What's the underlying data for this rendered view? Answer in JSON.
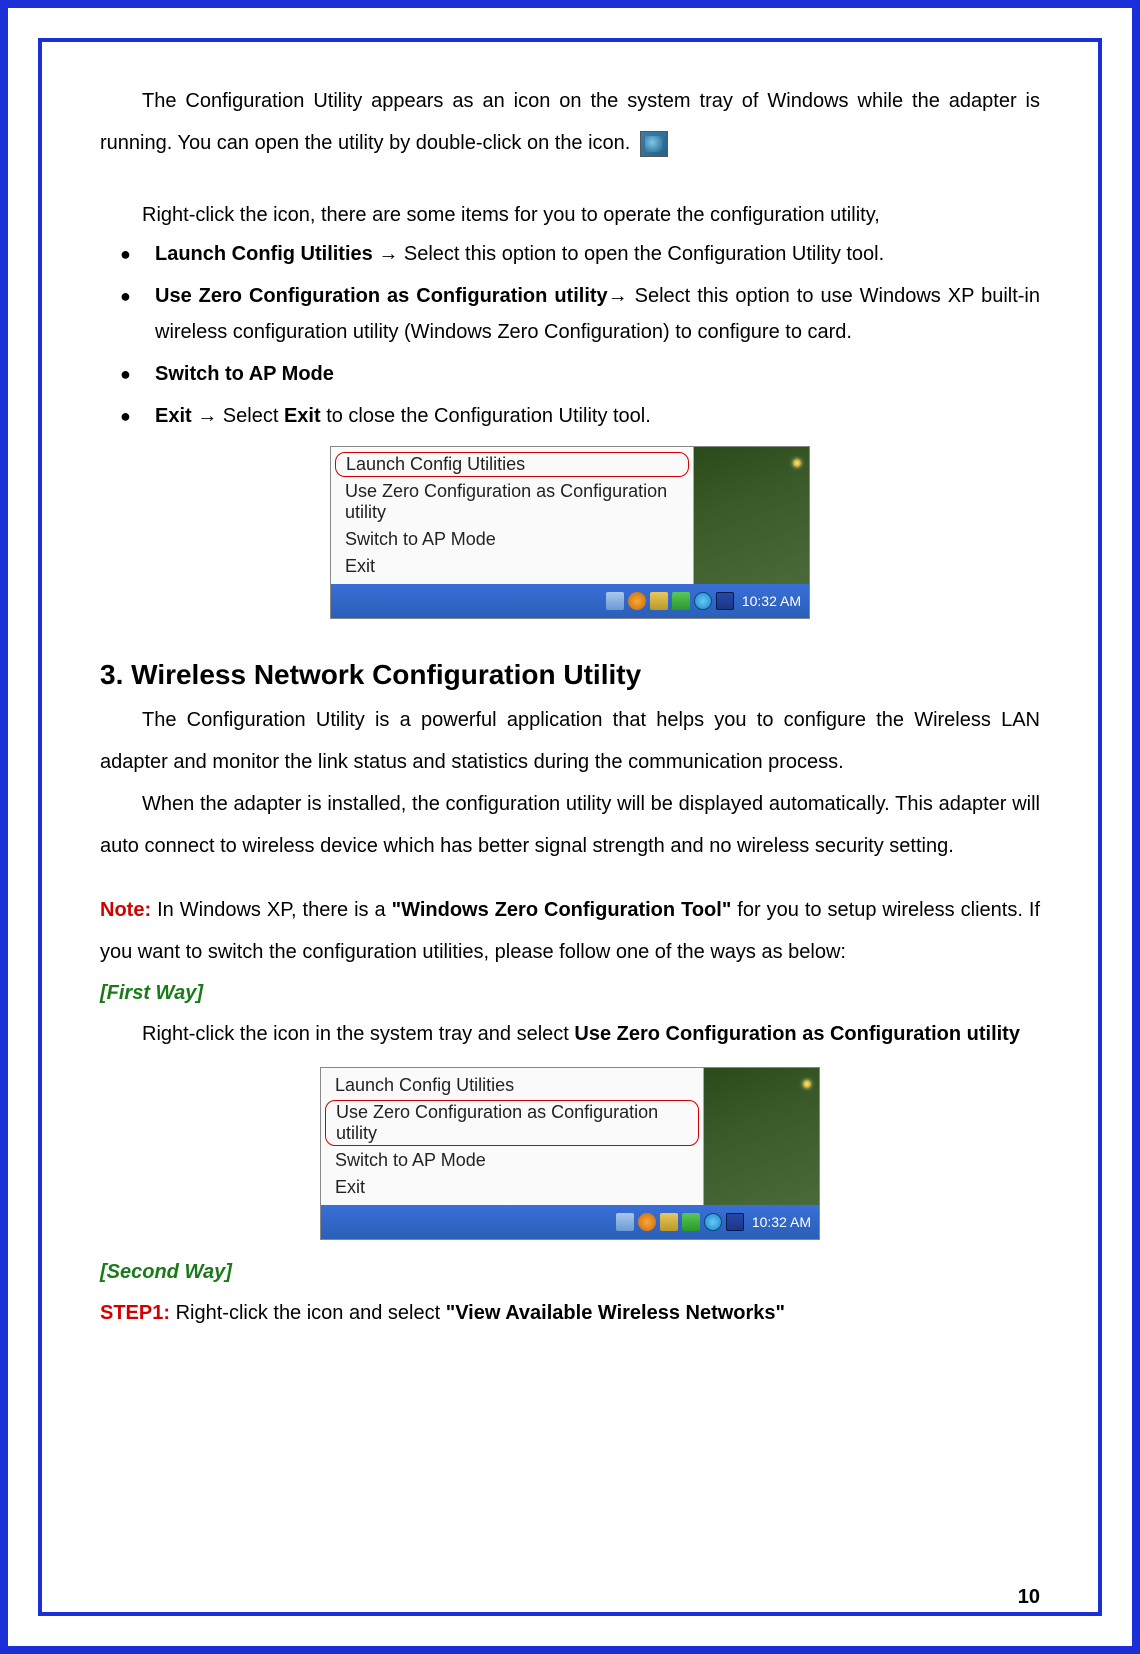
{
  "p1_a": "The Configuration Utility appears as an icon on the system tray of Windows while the adapter is running. You can open the utility by double-click on the icon.",
  "p2": "Right-click the icon, there are some items for you to operate the configuration utility,",
  "bullets": {
    "b1_bold": "Launch Config Utilities",
    "b1_text": " → Select this option to open the Configuration Utility tool.",
    "b2_bold": "Use Zero Configuration as Configuration utility",
    "b2_text": "→ Select this option to use Windows XP built-in wireless configuration utility (Windows Zero Configuration) to configure to card.",
    "b3_bold": "Switch to AP Mode",
    "b4_bold": "Exit",
    "b4_mid": " → Select ",
    "b4_bold2": "Exit",
    "b4_text": " to close the Configuration Utility tool."
  },
  "menu1": {
    "items": [
      "Launch Config Utilities",
      "Use Zero Configuration as Configuration utility",
      "Switch to AP Mode",
      "Exit"
    ],
    "highlighted_index": 0,
    "time": "10:32 AM"
  },
  "heading": "3. Wireless Network Configuration Utility",
  "p3": "The Configuration Utility is a powerful application that helps you to configure the Wireless LAN adapter and monitor the link status and statistics during the communication process.",
  "p4": "When the adapter is installed, the configuration utility will be displayed automatically. This adapter will auto connect to wireless device which has better signal strength and no wireless security setting.",
  "note_label": "Note:",
  "note_a": " In Windows XP, there is a ",
  "note_bold": "\"Windows Zero Configuration Tool\"",
  "note_b": " for you to setup wireless clients. If you want to switch the configuration utilities, please follow one of the ways as below:",
  "first_way": "[First Way]",
  "fw_a": "Right-click the icon in the system tray and select ",
  "fw_bold": "Use Zero Configuration as Configuration utility",
  "menu2": {
    "items": [
      "Launch Config Utilities",
      "Use Zero Configuration as Configuration utility",
      "Switch to AP Mode",
      "Exit"
    ],
    "highlighted_index": 1,
    "time": "10:32 AM"
  },
  "second_way": "[Second Way]",
  "step1_label": "STEP1:",
  "step1_a": " Right-click the icon and select ",
  "step1_bold": "\"View Available Wireless Networks\"",
  "page_number": "10"
}
